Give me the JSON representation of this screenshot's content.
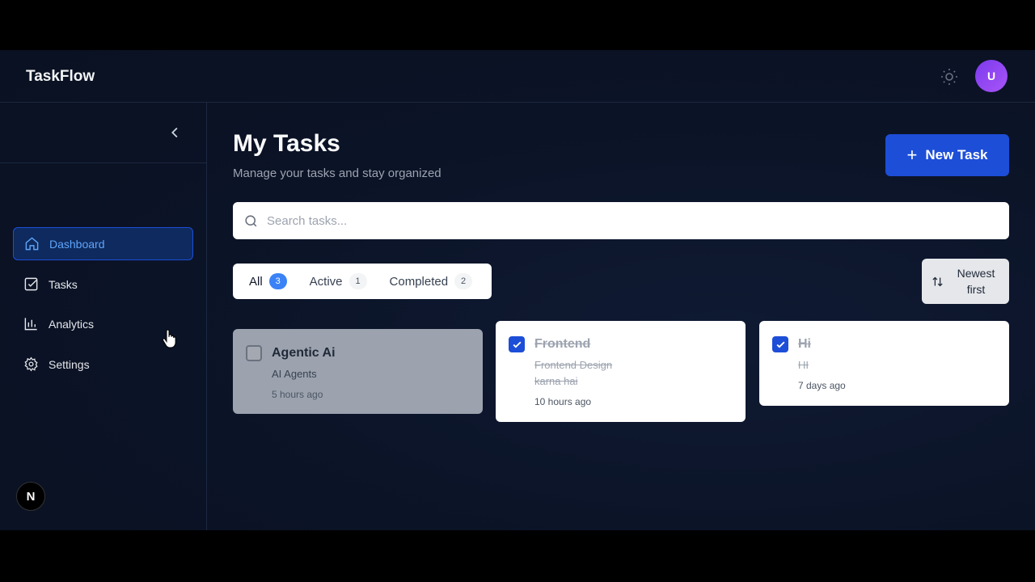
{
  "app": {
    "brand": "TaskFlow",
    "avatar_initial": "U",
    "accent": "#1d4ed8"
  },
  "sidebar": {
    "items": [
      {
        "label": "Dashboard",
        "icon": "home-icon",
        "active": true
      },
      {
        "label": "Tasks",
        "icon": "checkbox-icon"
      },
      {
        "label": "Analytics",
        "icon": "bar-chart-icon"
      },
      {
        "label": "Settings",
        "icon": "gear-icon"
      }
    ],
    "badge": "N"
  },
  "main": {
    "title": "My Tasks",
    "subtitle": "Manage your tasks and stay organized",
    "new_task_label": "New Task",
    "search_placeholder": "Search tasks...",
    "filters": [
      {
        "label": "All",
        "count": "3",
        "selected": true
      },
      {
        "label": "Active",
        "count": "1"
      },
      {
        "label": "Completed",
        "count": "2"
      }
    ],
    "sort_label": "Newest first"
  },
  "tasks": [
    {
      "title": "Agentic Ai",
      "description": "AI Agents",
      "time": "5 hours ago",
      "completed": false
    },
    {
      "title": "Frontend",
      "description": "Frontend Design karna hai",
      "time": "10 hours ago",
      "completed": true
    },
    {
      "title": "Hi",
      "description": "HI",
      "time": "7 days ago",
      "completed": true
    }
  ]
}
